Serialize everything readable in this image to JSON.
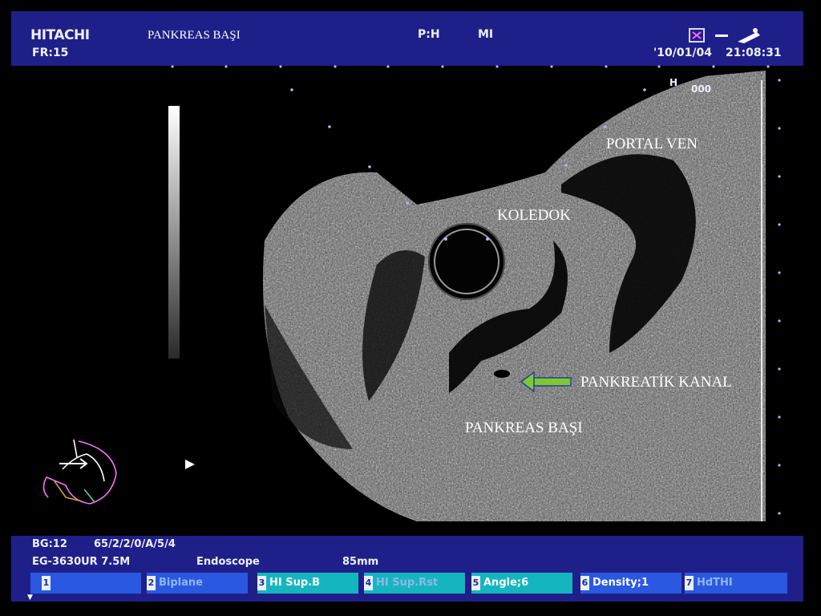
{
  "header": {
    "brand": "HITACHI",
    "frame_rate": "FR:15",
    "caption": "PANKREAS BAŞI",
    "probe_mode": "P:H",
    "mi_label": "MI",
    "date": "'10/01/04",
    "time": "21:08:31",
    "icons": [
      "depth-marker-icon",
      "dash-icon",
      "probe-icon"
    ]
  },
  "image": {
    "h_label": "H",
    "h_value": "000",
    "annotations": {
      "portal_ven": "PORTAL VEN",
      "koledok": "KOLEDOK",
      "pankreatik_kanal": "PANKREATİK KANAL",
      "pankreas_basi": "PANKREAS BAŞI"
    },
    "arrow_color": "#7ec832",
    "icons": [
      "grayscale-bar-icon",
      "body-mark-icon",
      "focus-marker-icon",
      "pointer-arrow-icon"
    ]
  },
  "status": {
    "line1_a": "BG:12",
    "line1_b": "65/2/2/0/A/5/4",
    "line2_a": "EG-3630UR 7.5M",
    "line2_b": "Endoscope",
    "line2_c": "85mm"
  },
  "softkeys": [
    {
      "num": "1",
      "label": ""
    },
    {
      "num": "2",
      "label": "Biplane"
    },
    {
      "num": "3",
      "label": "HI Sup.B"
    },
    {
      "num": "4",
      "label": "HI Sup.Rst"
    },
    {
      "num": "5",
      "label": "Angle;6"
    },
    {
      "num": "6",
      "label": "Density;1"
    },
    {
      "num": "7",
      "label": "HdTHI"
    }
  ],
  "colors": {
    "header_bg": "#1f1f8a",
    "softkey_blue": "#2a58e0",
    "softkey_teal": "#15b5c0"
  }
}
